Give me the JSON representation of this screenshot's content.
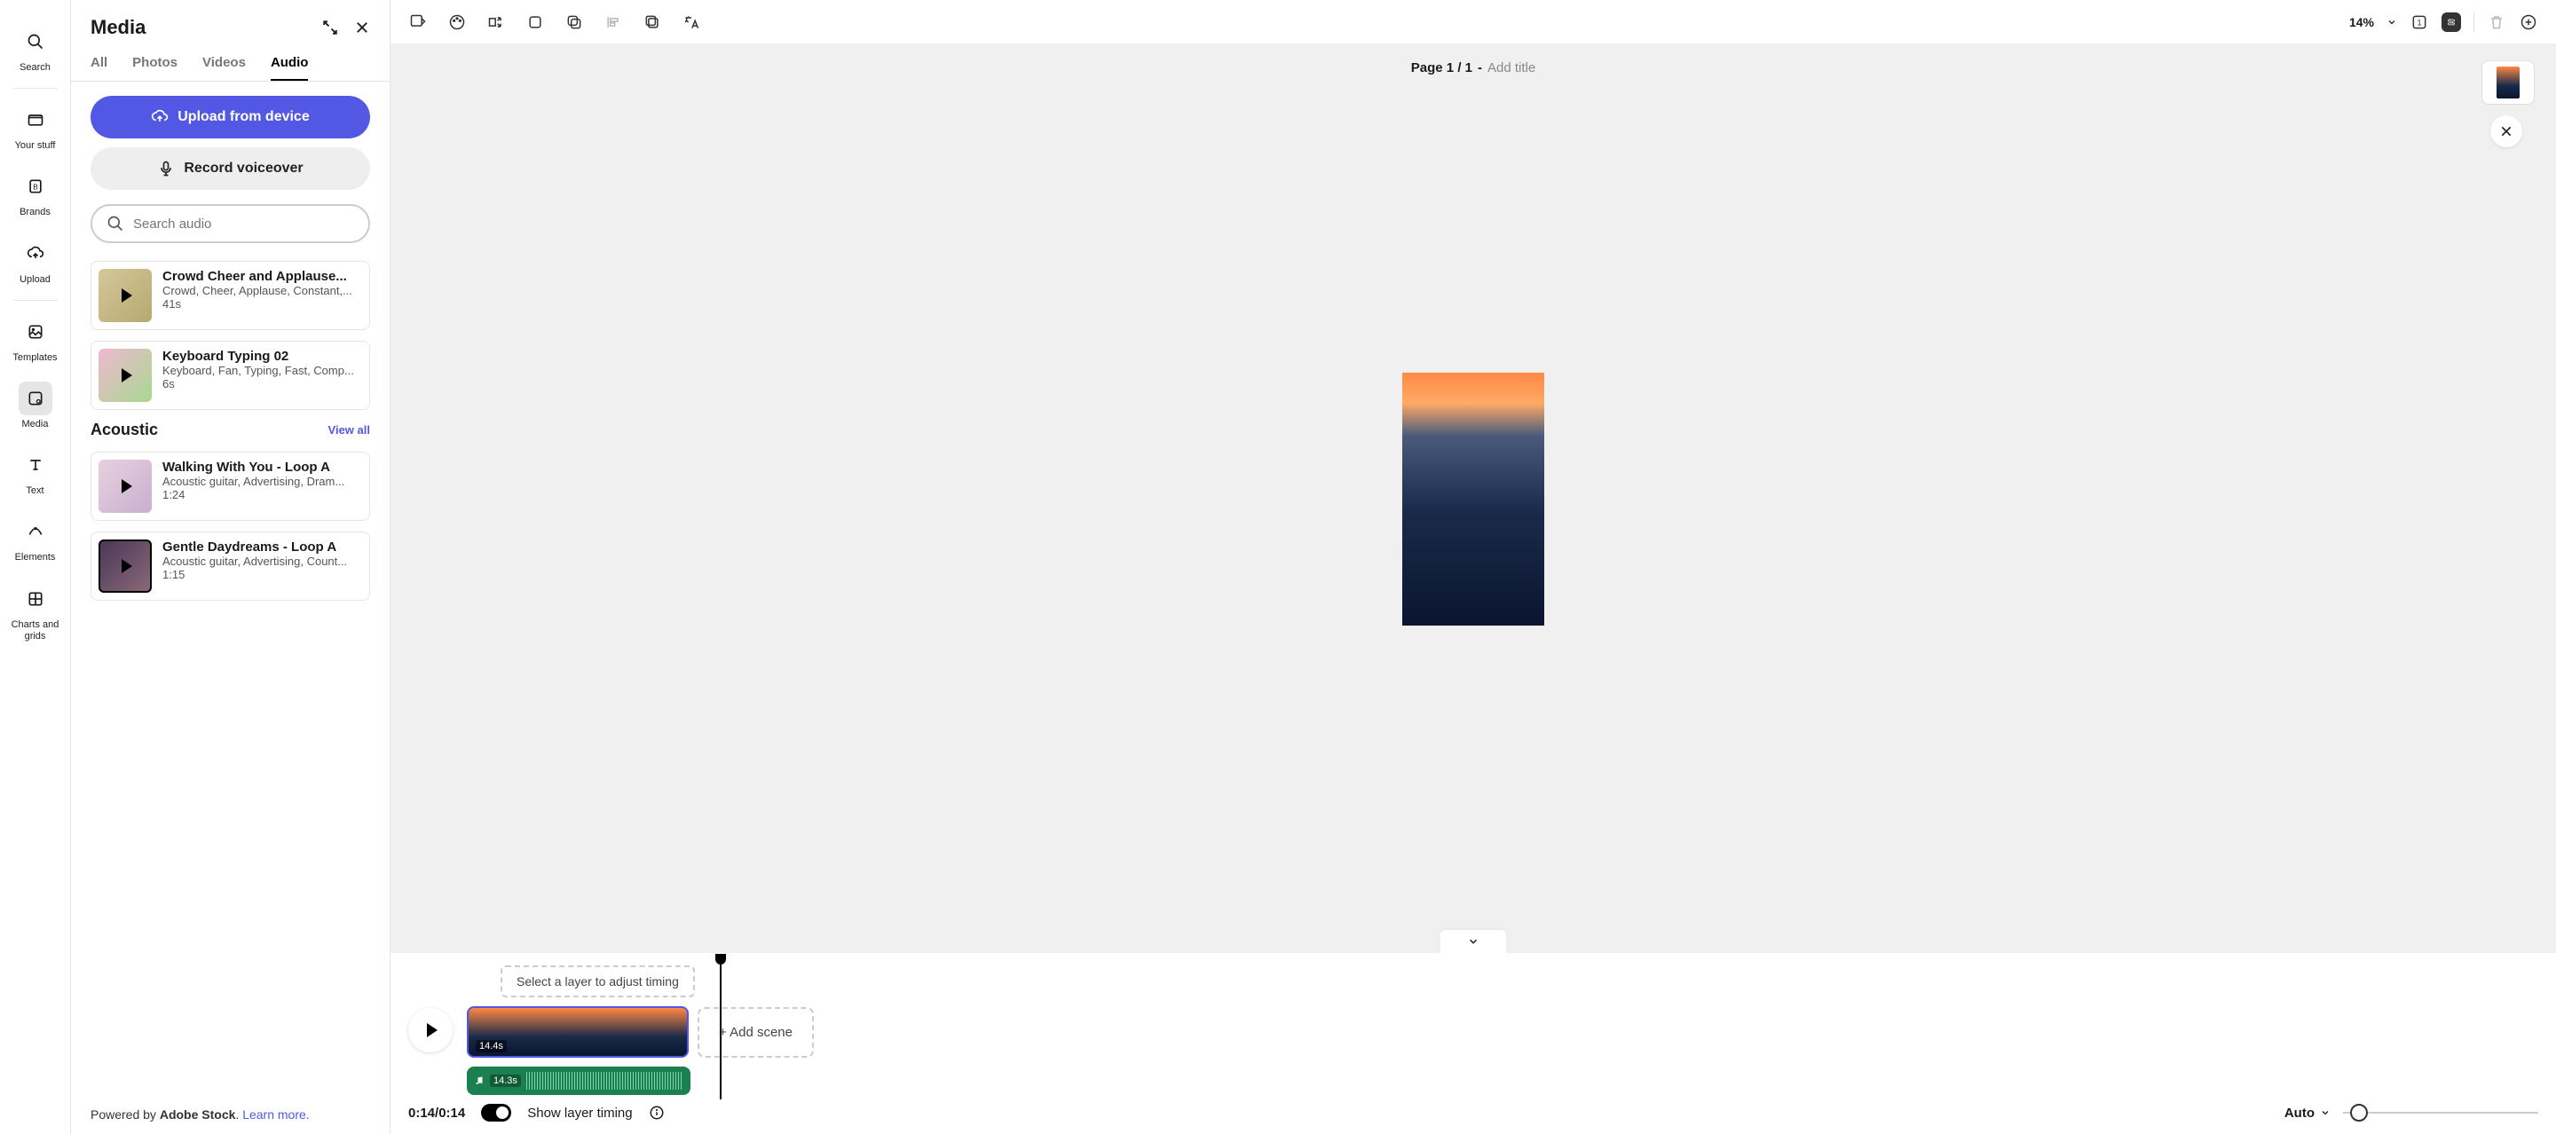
{
  "leftRail": {
    "search": "Search",
    "yourStuff": "Your stuff",
    "brands": "Brands",
    "upload": "Upload",
    "templates": "Templates",
    "media": "Media",
    "text": "Text",
    "elements": "Elements",
    "charts": "Charts and grids"
  },
  "panel": {
    "title": "Media",
    "tabs": {
      "all": "All",
      "photos": "Photos",
      "videos": "Videos",
      "audio": "Audio"
    },
    "uploadBtn": "Upload from device",
    "recordBtn": "Record voiceover",
    "searchPlaceholder": "Search audio",
    "sections": {
      "acoustic": "Acoustic",
      "viewAll": "View all"
    },
    "items": [
      {
        "title": "Crowd Cheer and Applause...",
        "tags": "Crowd, Cheer, Applause, Constant,...",
        "dur": "41s"
      },
      {
        "title": "Keyboard Typing 02",
        "tags": "Keyboard, Fan, Typing, Fast, Comp...",
        "dur": "6s"
      },
      {
        "title": "Walking With You - Loop A",
        "tags": "Acoustic guitar, Advertising, Dram...",
        "dur": "1:24"
      },
      {
        "title": "Gentle Daydreams - Loop A",
        "tags": "Acoustic guitar, Advertising, Count...",
        "dur": "1:15"
      }
    ],
    "footer": {
      "prefix": "Powered by ",
      "brand": "Adobe Stock",
      "suffix": ". ",
      "link": "Learn more."
    }
  },
  "toolbar": {
    "zoom": "14%"
  },
  "canvas": {
    "pageLabel": "Page 1 / 1",
    "dash": " - ",
    "addTitle": "Add title"
  },
  "timeline": {
    "hint": "Select a layer to adjust timing",
    "videoDur": "14.4s",
    "audioDur": "14.3s",
    "addScene": "+ Add scene",
    "time": "0:14/0:14",
    "showTiming": "Show layer timing",
    "auto": "Auto"
  }
}
